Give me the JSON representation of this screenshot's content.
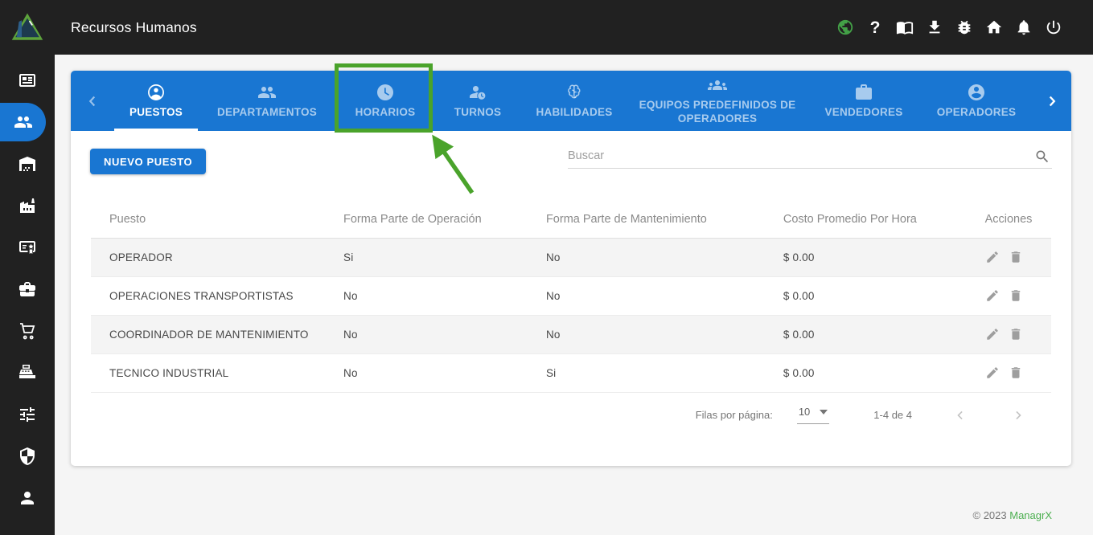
{
  "topbar": {
    "title": "Recursos Humanos",
    "help_glyph": "?",
    "icons": [
      "globe-icon",
      "help-icon",
      "docs-book-icon",
      "download-icon",
      "bug-icon",
      "home-icon",
      "notifications-bell-icon",
      "power-icon"
    ]
  },
  "sidebar": {
    "items": [
      {
        "icon": "newspaper",
        "active": false
      },
      {
        "icon": "people-hr",
        "active": true
      },
      {
        "icon": "warehouse",
        "active": false
      },
      {
        "icon": "factory",
        "active": false
      },
      {
        "icon": "certificate",
        "active": false
      },
      {
        "icon": "business-center",
        "active": false
      },
      {
        "icon": "shopping-cart",
        "active": false
      },
      {
        "icon": "cash-register",
        "active": false
      },
      {
        "icon": "tune-sliders",
        "active": false
      },
      {
        "icon": "security-shield",
        "active": false
      },
      {
        "icon": "person",
        "active": false
      }
    ]
  },
  "tabs": {
    "items": [
      {
        "label": "PUESTOS",
        "icon": "account-circle-outline",
        "active": true
      },
      {
        "label": "DEPARTAMENTOS",
        "icon": "people",
        "active": false
      },
      {
        "label": "HORARIOS",
        "icon": "clock",
        "active": false,
        "highlighted": true
      },
      {
        "label": "TURNOS",
        "icon": "person-clock",
        "active": false
      },
      {
        "label": "HABILIDADES",
        "icon": "brain",
        "active": false
      },
      {
        "label": "EQUIPOS PREDEFINIDOS DE OPERADORES",
        "icon": "groups",
        "active": false
      },
      {
        "label": "VENDEDORES",
        "icon": "briefcase",
        "active": false
      },
      {
        "label": "OPERADORES",
        "icon": "account-circle-filled",
        "active": false
      }
    ]
  },
  "toolbar": {
    "new_button_label": "NUEVO PUESTO",
    "search_placeholder": "Buscar"
  },
  "table": {
    "columns": [
      "Puesto",
      "Forma Parte de Operación",
      "Forma Parte de Mantenimiento",
      "Costo Promedio Por Hora",
      "Acciones"
    ],
    "rows": [
      {
        "puesto": "OPERADOR",
        "operacion": "Si",
        "mantenimiento": "No",
        "costo": "$ 0.00"
      },
      {
        "puesto": "OPERACIONES TRANSPORTISTAS",
        "operacion": "No",
        "mantenimiento": "No",
        "costo": "$ 0.00"
      },
      {
        "puesto": "COORDINADOR DE MANTENIMIENTO",
        "operacion": "No",
        "mantenimiento": "No",
        "costo": "$ 0.00"
      },
      {
        "puesto": "TECNICO INDUSTRIAL",
        "operacion": "No",
        "mantenimiento": "Si",
        "costo": "$ 0.00"
      }
    ]
  },
  "pagination": {
    "rows_per_page_label": "Filas por página:",
    "rows_per_page_value": "10",
    "range_label": "1-4 de 4"
  },
  "footer": {
    "copyright": "© 2023",
    "brand_name": "ManagrX"
  },
  "annotation": {
    "highlighted_tab": "HORARIOS",
    "highlight_color": "#4aa32b"
  },
  "colors": {
    "accent_blue": "#1976d2",
    "topbar_bg": "#212121",
    "brand_green": "#4caf50"
  }
}
